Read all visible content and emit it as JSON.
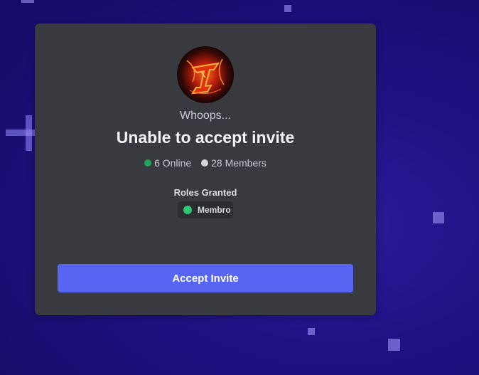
{
  "invite": {
    "subtitle": "Whoops...",
    "title": "Unable to accept invite",
    "online_text": "6 Online",
    "members_text": "28 Members",
    "roles_label": "Roles Granted",
    "role_name": "Membro",
    "accept_label": "Accept Invite"
  },
  "icons": {
    "avatar": "server-avatar-icon",
    "online": "online-status-dot",
    "members": "members-status-dot",
    "role": "role-color-dot"
  },
  "colors": {
    "accent": "#5865f2",
    "online": "#23a55a",
    "role": "#2dc770",
    "card": "#393a40"
  }
}
